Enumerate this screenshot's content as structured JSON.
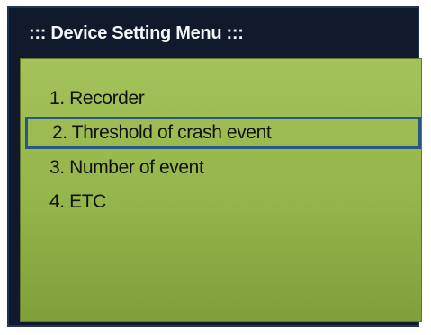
{
  "window": {
    "title": "::: Device Setting Menu :::"
  },
  "menu": {
    "selected_index": 1,
    "items": [
      {
        "label": "1. Recorder"
      },
      {
        "label": "2. Threshold of crash event"
      },
      {
        "label": "3. Number of event"
      },
      {
        "label": "4. ETC"
      }
    ]
  },
  "colors": {
    "frame_background": "#101a2c",
    "panel_green": "#9bbb50",
    "selection_border": "#285780",
    "title_text": "#f4f6f8",
    "item_text": "#111111"
  }
}
